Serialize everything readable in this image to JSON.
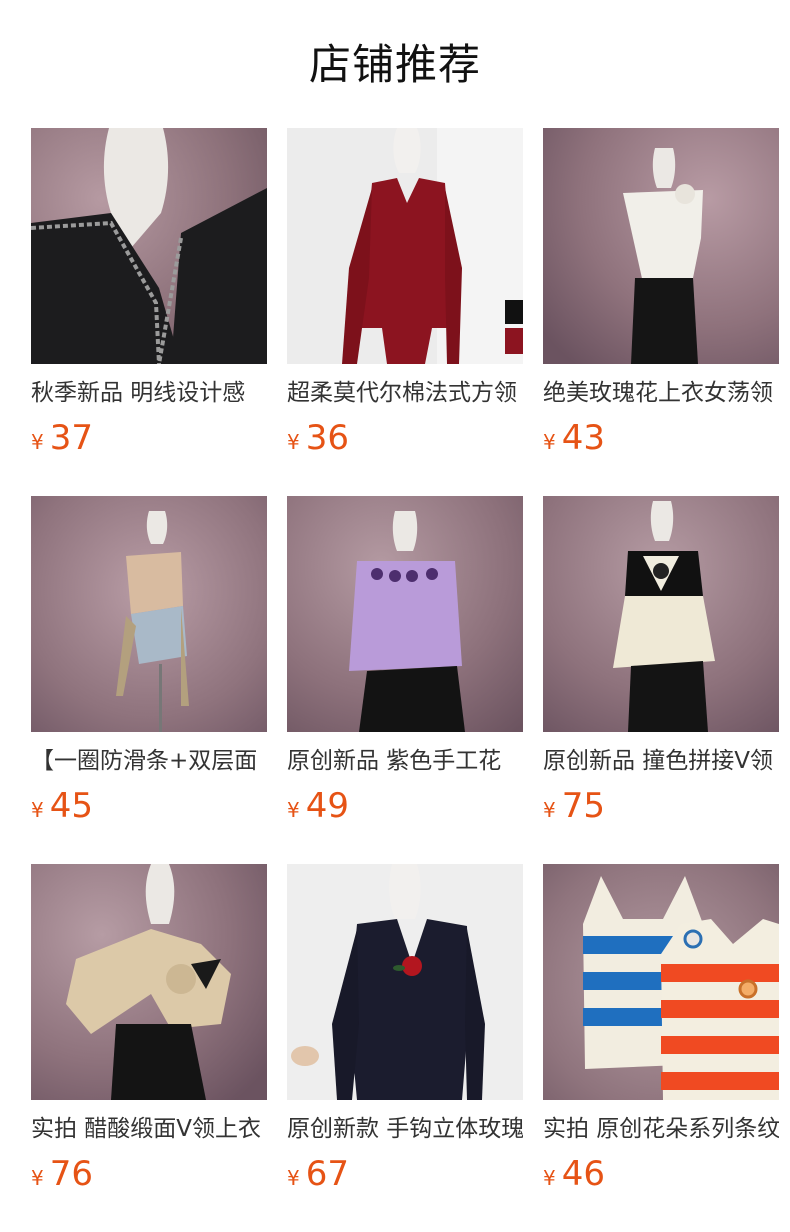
{
  "title": "店铺推荐",
  "currency_symbol": "¥",
  "colors": {
    "price": "#e65315",
    "backdrop_mauve": "#9a8088",
    "backdrop_light": "#ececec"
  },
  "products": [
    {
      "name": "秋季新品 明线设计感",
      "price": "37",
      "thumb": "black-top-on-mauve"
    },
    {
      "name": "超柔莫代尔棉法式方领",
      "price": "36",
      "thumb": "red-longsleeve-on-white"
    },
    {
      "name": "绝美玫瑰花上衣女荡领",
      "price": "43",
      "thumb": "white-top-on-mauve"
    },
    {
      "name": "【一圈防滑条+双层面",
      "price": "45",
      "thumb": "beige-tube-top-on-mauve"
    },
    {
      "name": "原创新品 紫色手工花",
      "price": "49",
      "thumb": "purple-camisole-on-mauve"
    },
    {
      "name": "原创新品 撞色拼接V领",
      "price": "75",
      "thumb": "black-cream-peplum-on-mauve"
    },
    {
      "name": "实拍 醋酸缎面V领上衣",
      "price": "76",
      "thumb": "champagne-satin-wrap-on-mauve"
    },
    {
      "name": "原创新款 手钩立体玫瑰",
      "price": "67",
      "thumb": "navy-vneck-on-white"
    },
    {
      "name": "实拍 原创花朵系列条纹",
      "price": "46",
      "thumb": "striped-knit-tanks-on-mauve"
    }
  ]
}
